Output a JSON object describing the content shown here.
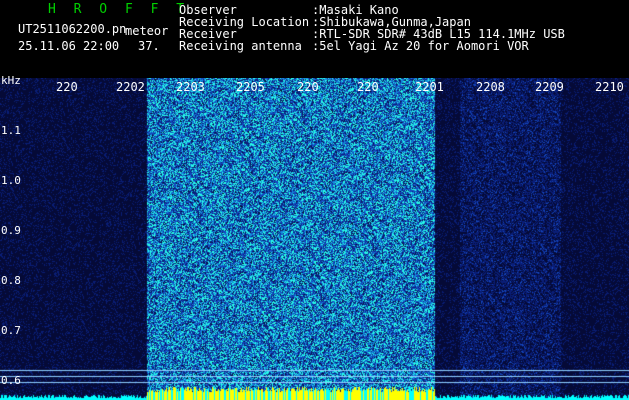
{
  "header": {
    "brand": "H R O F F T",
    "filename": "UT2511062200.pn",
    "mode_label": "meteor",
    "datetime": "25.11.06 22:00",
    "count": "37."
  },
  "station": [
    {
      "key": "Observer",
      "value": ":Masaki Kano"
    },
    {
      "key": "Receiving Location",
      "value": ":Shibukawa,Gunma,Japan"
    },
    {
      "key": "Receiver",
      "value": ":RTL-SDR SDR# 43dB L15 114.1MHz USB"
    },
    {
      "key": "Receiving antenna",
      "value": ":5el Yagi Az 20 for Aomori VOR"
    }
  ],
  "spectrogram": {
    "y_unit": "kHz",
    "y_ticks": [
      "1.1",
      "1.0",
      "0.9",
      "0.8",
      "0.7",
      "0.6"
    ],
    "x_ticks": [
      "220",
      "2202",
      "2203",
      "2205",
      "220",
      "220",
      "2201",
      "2208",
      "2209",
      "2210"
    ],
    "colors": {
      "background": "#050a30",
      "signal": "#00ffff",
      "strong": "#ffff00",
      "text": "#ffffff",
      "brand": "#00d000"
    }
  }
}
